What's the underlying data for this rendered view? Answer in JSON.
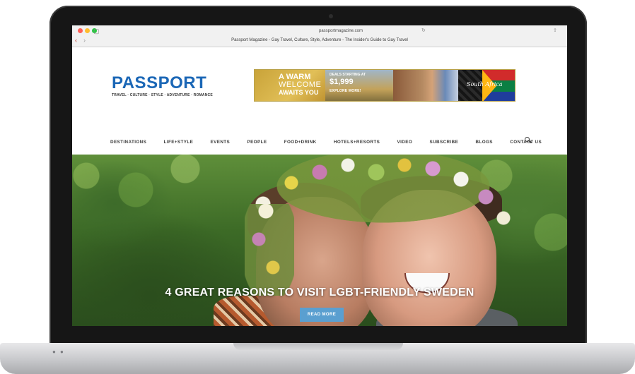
{
  "browser": {
    "url": "passportmagazine.com",
    "tab_title": "Passport Magazine - Gay Travel, Culture, Style, Adventure - The Insider's Guide to Gay Travel"
  },
  "site": {
    "logo": "PASSPORT",
    "tagline": "TRAVEL · CULTURE · STYLE · ADVENTURE · ROMANCE"
  },
  "ad": {
    "heading": "A WARM",
    "sub1": "WELCOME",
    "sub2": "AWAITS YOU",
    "deals": "DEALS STARTING AT",
    "price": "$1,999",
    "cta": "EXPLORE MORE!",
    "destination": "South Africa"
  },
  "nav": {
    "items": [
      "DESTINATIONS",
      "LIFE+STYLE",
      "EVENTS",
      "PEOPLE",
      "FOOD+DRINK",
      "HOTELS+RESORTS",
      "VIDEO",
      "SUBSCRIBE",
      "BLOGS",
      "CONTACT US"
    ],
    "search_icon": "search-icon"
  },
  "hero": {
    "title": "4 GREAT REASONS TO VISIT LGBT-FRIENDLY SWEDEN",
    "button": "READ MORE"
  },
  "colors": {
    "brand_blue": "#1b67b6",
    "button_blue": "#5a9fd0"
  }
}
